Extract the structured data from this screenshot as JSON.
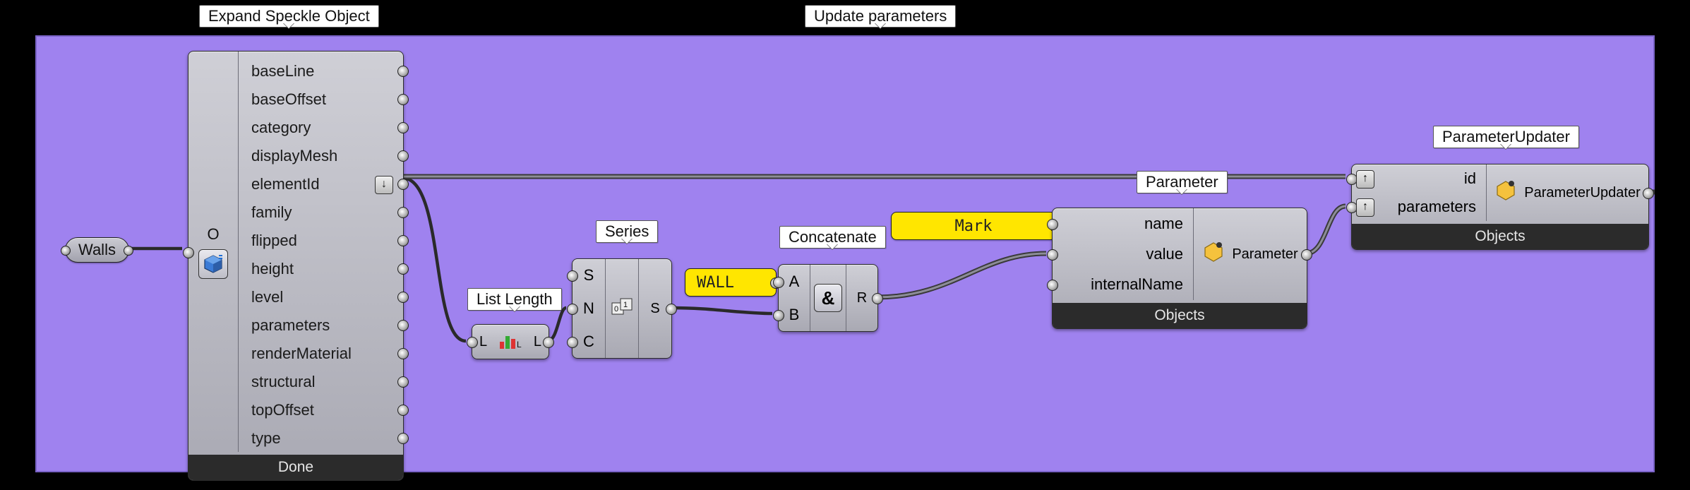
{
  "tooltips": {
    "expand": "Expand Speckle Object",
    "update": "Update parameters",
    "listLength": "List Length",
    "series": "Series",
    "concat": "Concatenate",
    "parameter": "Parameter",
    "updater": "ParameterUpdater"
  },
  "walls": {
    "label": "Walls"
  },
  "expand": {
    "input": "O",
    "outputs": [
      "baseLine",
      "baseOffset",
      "category",
      "displayMesh",
      "elementId",
      "family",
      "flipped",
      "height",
      "level",
      "parameters",
      "renderMaterial",
      "structural",
      "topOffset",
      "type"
    ],
    "footer": "Done"
  },
  "listLength": {
    "in": "L",
    "out": "L"
  },
  "series": {
    "inputs": [
      "S",
      "N",
      "C"
    ],
    "output": "S"
  },
  "panels": {
    "wall": "WALL",
    "mark": "Mark"
  },
  "concat": {
    "inputs": [
      "A",
      "B"
    ],
    "output": "R",
    "symbol": "&"
  },
  "parameter": {
    "inputs": [
      "name",
      "value",
      "internalName"
    ],
    "output": "Parameter",
    "footer": "Objects"
  },
  "updater": {
    "inputs": [
      "id",
      "parameters"
    ],
    "output": "ParameterUpdater",
    "footer": "Objects"
  }
}
